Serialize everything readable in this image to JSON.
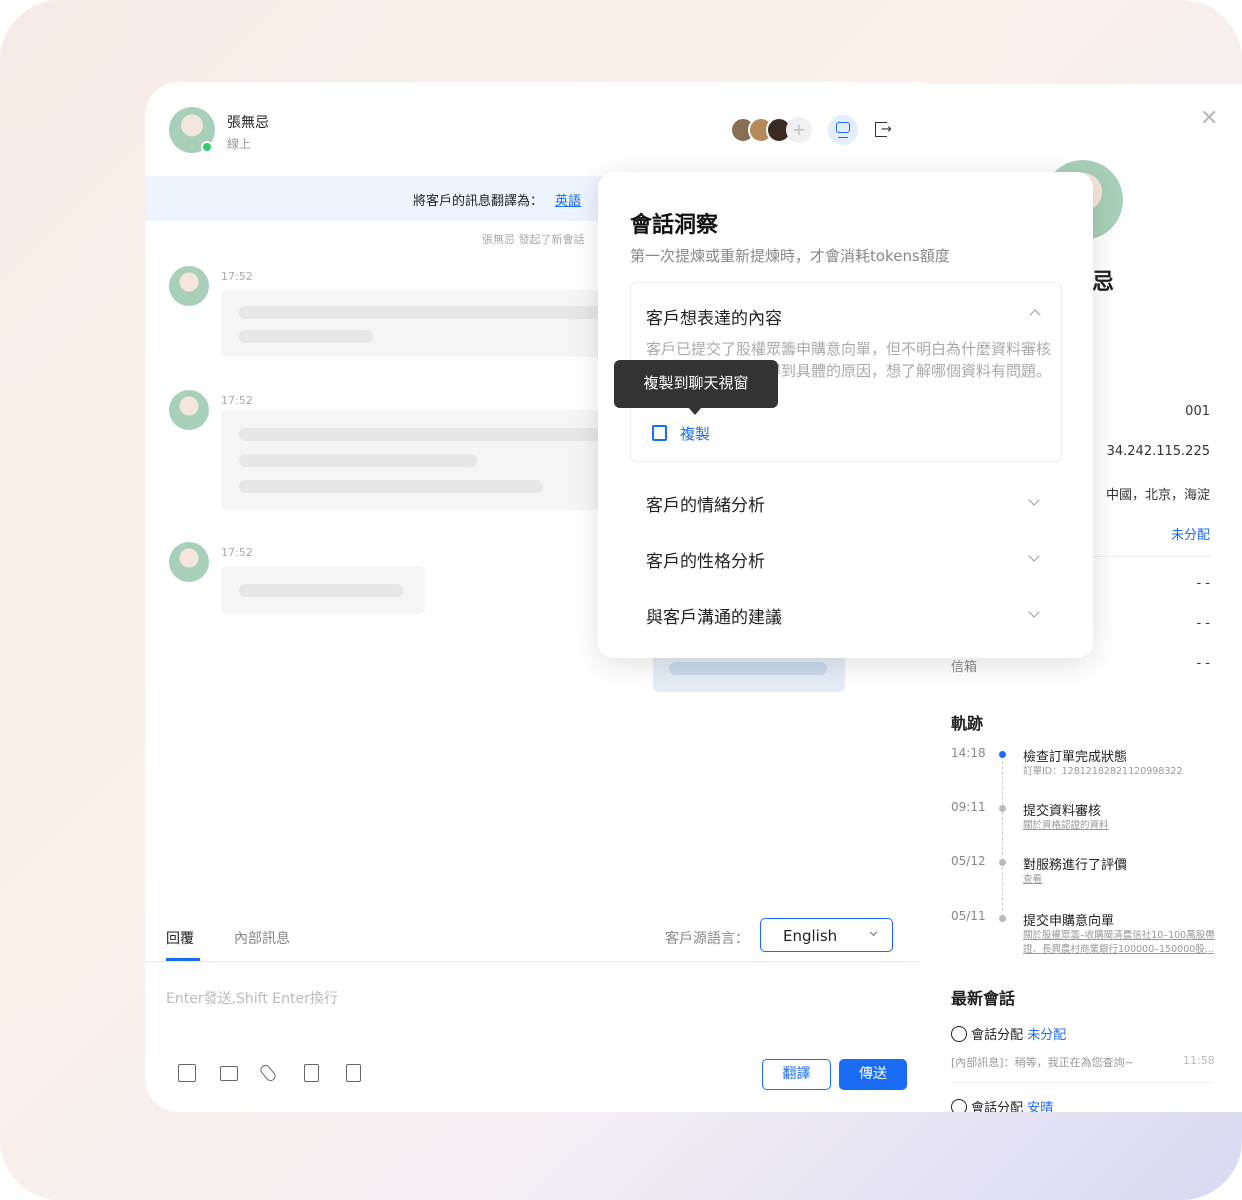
{
  "header": {
    "name": "張無忌",
    "status": "線上"
  },
  "translate_bar": {
    "text": "將客戶的訊息翻譯為：",
    "language": "英語"
  },
  "system_msg": "張無忌 發起了新會話",
  "messages": [
    {
      "time": "17:52"
    },
    {
      "time": "17:52"
    },
    {
      "time": "17:52"
    }
  ],
  "composer": {
    "tabs": [
      "回覆",
      "內部訊息"
    ],
    "source_lang_label": "客戶源語言：",
    "source_lang": "English",
    "placeholder": "Enter發送,Shift Enter換行",
    "translate_button": "翻譯",
    "send_button": "傳送",
    "tools": [
      "text-icon",
      "folder-icon",
      "paperclip-icon",
      "checklist-icon",
      "bookmark-icon"
    ]
  },
  "popover": {
    "title": "會話洞察",
    "subtitle": "第一次提煉或重新提煉時，才會消耗tokens額度",
    "sections": [
      {
        "title": "客戶想表達的內容",
        "expanded": true,
        "content": "客戶已提交了股權眾籌申購意向單，但不明白為什麼資料審核未通過，客戶希望得到具體的原因，想了解哪個資料有問題。",
        "copy_label": "複製",
        "tooltip": "複製到聊天視窗"
      },
      {
        "title": "客戶的情緒分析",
        "expanded": false
      },
      {
        "title": "客戶的性格分析",
        "expanded": false
      },
      {
        "title": "與客戶溝通的建議",
        "expanded": false
      }
    ]
  },
  "profile": {
    "name_fragment": "忌",
    "fields": [
      {
        "value": "001"
      },
      {
        "value": "34.242.115.225"
      },
      {
        "value": "中國，北京，海淀"
      },
      {
        "value": "未分配"
      },
      {
        "value": "- -"
      },
      {
        "value": "- -"
      },
      {
        "label": "信箱",
        "value": "- -"
      }
    ]
  },
  "trail": {
    "title": "軌跡",
    "items": [
      {
        "time": "14:18",
        "title": "檢查訂單完成狀態",
        "sub": "訂單ID：12812182821120998322",
        "active": true
      },
      {
        "time": "09:11",
        "title": "提交資料審核",
        "sub": "關於資格認證的資料"
      },
      {
        "time": "05/12",
        "title": "對服務進行了評價",
        "sub": "查看"
      },
      {
        "time": "05/11",
        "title": "提交申購意向單",
        "sub": "關於股權眾籌–收購閩清農信社10–100萬股帶證、長興農村商業銀行100000–150000股..."
      }
    ]
  },
  "recent": {
    "title": "最新會話",
    "items": [
      {
        "label": "會話分配",
        "assignee": "未分配",
        "preview": "[內部訊息]：稍等，我正在為您查詢~",
        "time": "11:58"
      },
      {
        "label": "會話分配",
        "assignee": "安晴"
      }
    ]
  },
  "colors": {
    "accent": "#1a6cf5",
    "online": "#2ed06e"
  }
}
